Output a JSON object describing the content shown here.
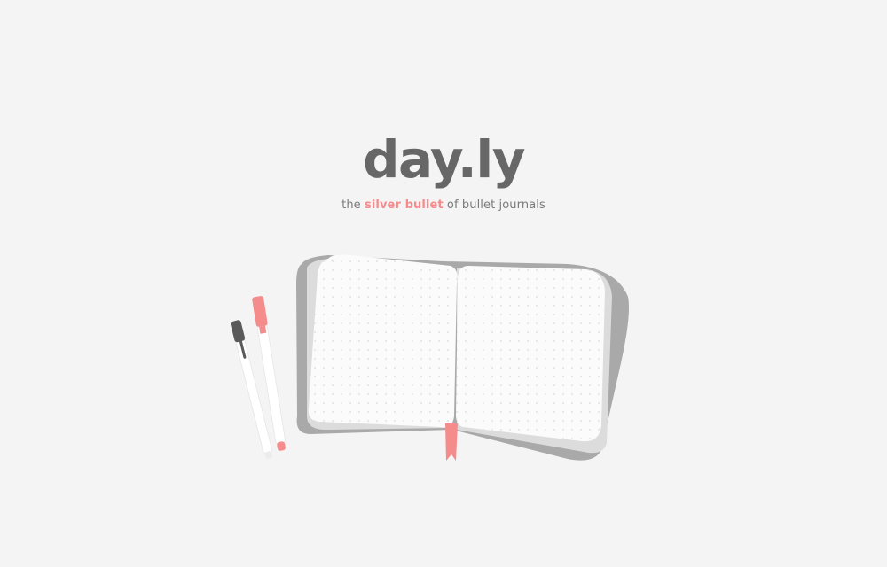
{
  "app": {
    "title": "day.ly",
    "tagline": {
      "prefix": "the ",
      "highlight": "silver bullet",
      "suffix": " of bullet journals"
    }
  },
  "illustration": {
    "name": "open-dotted-journal-with-pens",
    "colors": {
      "background": "#f4f4f4",
      "cover": "#a9a9a9",
      "page_shadow": "#dcdcdc",
      "page": "#fbfbfb",
      "dot": "#dadada",
      "ribbon": "#f48c8c",
      "pen_accent": "#f48c8c",
      "pen_dark": "#5a5a5a",
      "pen_body": "#ffffff"
    }
  }
}
